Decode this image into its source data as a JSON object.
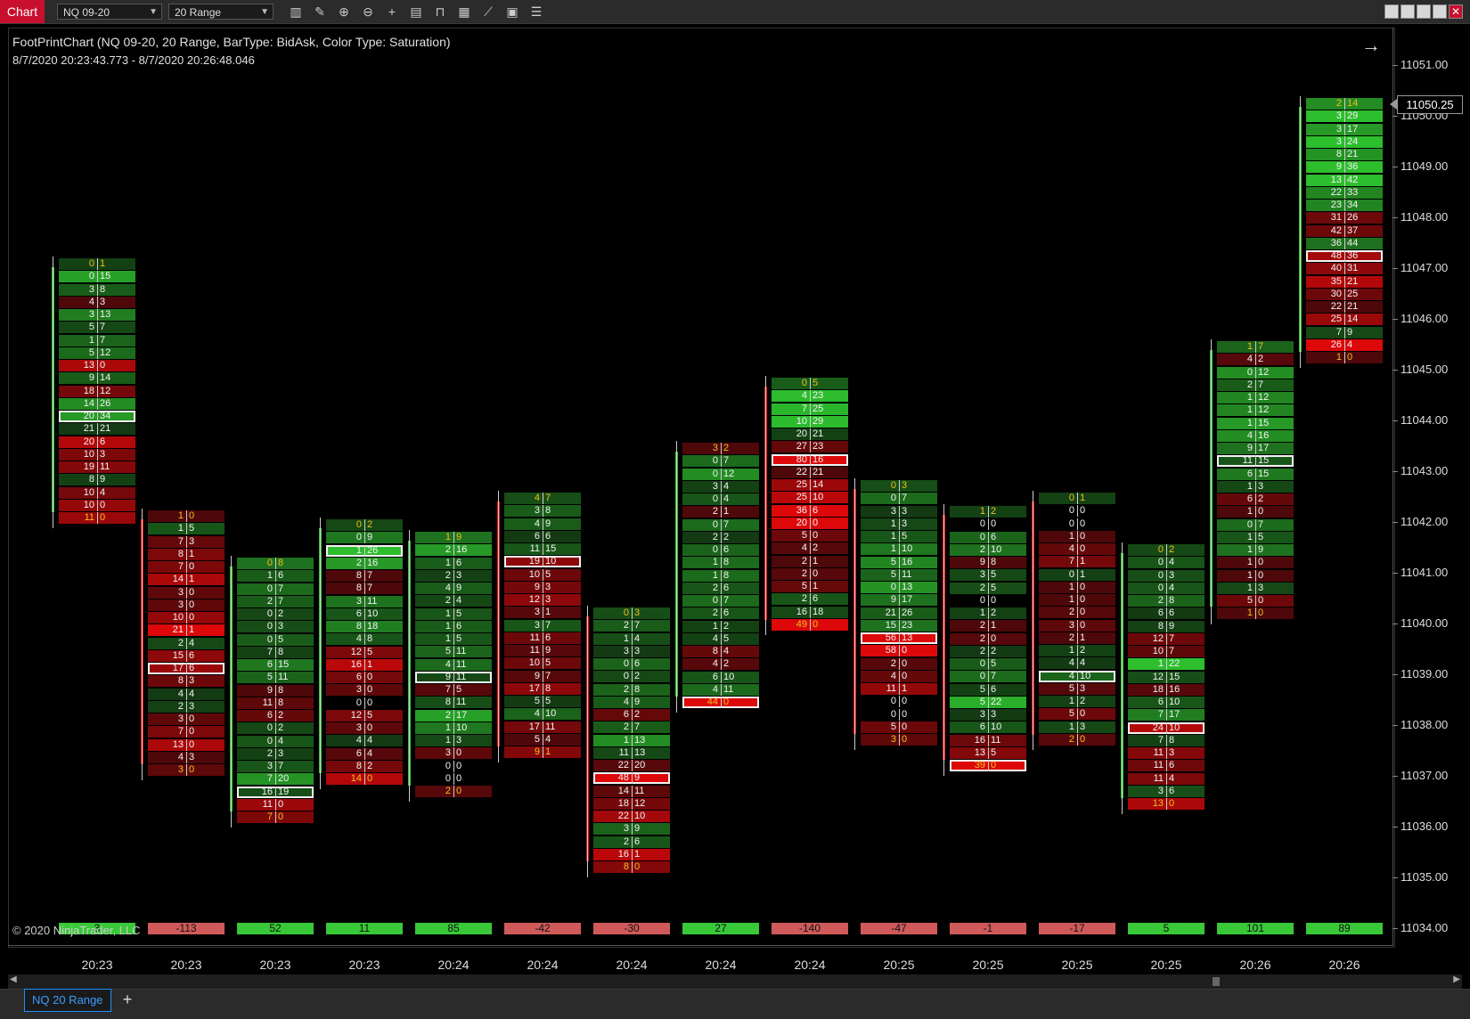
{
  "window": {
    "title": "Chart",
    "instrument": "NQ 09-20",
    "bar_type": "20 Range"
  },
  "toolbar_icons": [
    "bar-type-icon",
    "drawing-tool-icon",
    "zoom-in-icon",
    "zoom-out-icon",
    "crosshair-icon",
    "data-box-icon",
    "properties-icon",
    "indicators-icon",
    "strategies-icon",
    "chart-trader-icon",
    "more-options-icon"
  ],
  "chart": {
    "title": "FootPrintChart (NQ 09-20, 20 Range, BarType: BidAsk, Color Type: Saturation)",
    "range": "8/7/2020 20:23:43.773 - 8/7/2020 20:26:48.046",
    "copyright": "© 2020 NinjaTrader, LLC",
    "last_price": "11050.25"
  },
  "price_axis": [
    "11051.00",
    "11050.00",
    "11049.00",
    "11048.00",
    "11047.00",
    "11046.00",
    "11045.00",
    "11044.00",
    "11043.00",
    "11042.00",
    "11041.00",
    "11040.00",
    "11039.00",
    "11038.00",
    "11037.00",
    "11036.00",
    "11035.00",
    "11034.00"
  ],
  "time_labels": [
    "20:23",
    "20:23",
    "20:23",
    "20:23",
    "20:24",
    "20:24",
    "20:24",
    "20:24",
    "20:24",
    "20:25",
    "20:25",
    "20:25",
    "20:25",
    "20:26",
    "20:26"
  ],
  "bars": [
    {
      "cells": [
        [
          0,
          1
        ],
        [
          0,
          15
        ],
        [
          3,
          8
        ],
        [
          4,
          3
        ],
        [
          3,
          13
        ],
        [
          5,
          7
        ],
        [
          1,
          7
        ],
        [
          5,
          12
        ],
        [
          13,
          0
        ],
        [
          9,
          14
        ],
        [
          18,
          12
        ],
        [
          14,
          26
        ],
        [
          20,
          34
        ],
        [
          21,
          21
        ],
        [
          20,
          6
        ],
        [
          10,
          3
        ],
        [
          19,
          11
        ],
        [
          8,
          9
        ],
        [
          10,
          4
        ],
        [
          10,
          0
        ],
        [
          11,
          0
        ]
      ],
      "poc": 12,
      "delta": "3"
    },
    {
      "cells": [
        [
          1,
          0
        ],
        [
          1,
          5
        ],
        [
          7,
          3
        ],
        [
          8,
          1
        ],
        [
          7,
          0
        ],
        [
          14,
          1
        ],
        [
          3,
          0
        ],
        [
          3,
          0
        ],
        [
          10,
          0
        ],
        [
          21,
          1
        ],
        [
          2,
          4
        ],
        [
          15,
          6
        ],
        [
          17,
          6
        ],
        [
          8,
          3
        ],
        [
          4,
          4
        ],
        [
          2,
          3
        ],
        [
          3,
          0
        ],
        [
          7,
          0
        ],
        [
          13,
          0
        ],
        [
          4,
          3
        ],
        [
          3,
          0
        ]
      ],
      "poc": 12,
      "delta": "-113"
    },
    {
      "cells": [
        [
          0,
          8
        ],
        [
          1,
          6
        ],
        [
          0,
          7
        ],
        [
          2,
          7
        ],
        [
          0,
          2
        ],
        [
          0,
          3
        ],
        [
          0,
          5
        ],
        [
          7,
          8
        ],
        [
          6,
          15
        ],
        [
          5,
          11
        ],
        [
          9,
          8
        ],
        [
          11,
          8
        ],
        [
          6,
          2
        ],
        [
          0,
          2
        ],
        [
          0,
          4
        ],
        [
          2,
          3
        ],
        [
          3,
          7
        ],
        [
          7,
          20
        ],
        [
          16,
          19
        ],
        [
          11,
          0
        ],
        [
          7,
          0
        ]
      ],
      "poc": 18,
      "delta": "52"
    },
    {
      "cells": [
        [
          0,
          2
        ],
        [
          0,
          9
        ],
        [
          1,
          26
        ],
        [
          2,
          16
        ],
        [
          8,
          7
        ],
        [
          8,
          7
        ],
        [
          3,
          11
        ],
        [
          6,
          10
        ],
        [
          8,
          18
        ],
        [
          4,
          8
        ],
        [
          12,
          5
        ],
        [
          16,
          1
        ],
        [
          6,
          0
        ],
        [
          3,
          0
        ],
        [
          0,
          0
        ],
        [
          12,
          5
        ],
        [
          3,
          0
        ],
        [
          4,
          4
        ],
        [
          6,
          4
        ],
        [
          8,
          2
        ],
        [
          14,
          0
        ]
      ],
      "poc": 2,
      "delta": "11"
    },
    {
      "cells": [
        [
          1,
          9
        ],
        [
          2,
          16
        ],
        [
          1,
          6
        ],
        [
          2,
          3
        ],
        [
          4,
          9
        ],
        [
          2,
          4
        ],
        [
          1,
          5
        ],
        [
          1,
          6
        ],
        [
          1,
          5
        ],
        [
          5,
          11
        ],
        [
          4,
          11
        ],
        [
          9,
          11
        ],
        [
          7,
          5
        ],
        [
          8,
          11
        ],
        [
          2,
          17
        ],
        [
          1,
          10
        ],
        [
          1,
          3
        ],
        [
          3,
          0
        ],
        [
          0,
          0
        ],
        [
          0,
          0
        ],
        [
          2,
          0
        ]
      ],
      "poc": 11,
      "delta": "85"
    },
    {
      "cells": [
        [
          4,
          7
        ],
        [
          3,
          8
        ],
        [
          4,
          9
        ],
        [
          6,
          6
        ],
        [
          11,
          15
        ],
        [
          19,
          10
        ],
        [
          10,
          5
        ],
        [
          9,
          3
        ],
        [
          12,
          3
        ],
        [
          3,
          1
        ],
        [
          3,
          7
        ],
        [
          11,
          6
        ],
        [
          11,
          9
        ],
        [
          10,
          5
        ],
        [
          9,
          7
        ],
        [
          17,
          8
        ],
        [
          5,
          5
        ],
        [
          4,
          10
        ],
        [
          17,
          11
        ],
        [
          5,
          4
        ],
        [
          9,
          1
        ]
      ],
      "poc": 5,
      "delta": "-42"
    },
    {
      "cells": [
        [
          0,
          3
        ],
        [
          2,
          7
        ],
        [
          1,
          4
        ],
        [
          3,
          3
        ],
        [
          0,
          6
        ],
        [
          0,
          2
        ],
        [
          2,
          8
        ],
        [
          4,
          9
        ],
        [
          6,
          2
        ],
        [
          2,
          7
        ],
        [
          1,
          13
        ],
        [
          11,
          13
        ],
        [
          22,
          20
        ],
        [
          48,
          9
        ],
        [
          14,
          11
        ],
        [
          18,
          12
        ],
        [
          22,
          10
        ],
        [
          3,
          9
        ],
        [
          2,
          6
        ],
        [
          16,
          1
        ],
        [
          8,
          0
        ]
      ],
      "poc": 13,
      "delta": "-30"
    },
    {
      "cells": [
        [
          3,
          2
        ],
        [
          0,
          7
        ],
        [
          0,
          12
        ],
        [
          3,
          4
        ],
        [
          0,
          4
        ],
        [
          2,
          1
        ],
        [
          0,
          7
        ],
        [
          2,
          2
        ],
        [
          0,
          6
        ],
        [
          1,
          8
        ],
        [
          1,
          8
        ],
        [
          2,
          6
        ],
        [
          0,
          7
        ],
        [
          2,
          6
        ],
        [
          1,
          2
        ],
        [
          4,
          5
        ],
        [
          8,
          4
        ],
        [
          4,
          2
        ],
        [
          6,
          10
        ],
        [
          4,
          11
        ],
        [
          44,
          0
        ]
      ],
      "poc": 20,
      "delta": "27"
    },
    {
      "cells": [
        [
          0,
          5
        ],
        [
          4,
          23
        ],
        [
          7,
          25
        ],
        [
          10,
          29
        ],
        [
          20,
          21
        ],
        [
          27,
          23
        ],
        [
          80,
          16
        ],
        [
          22,
          21
        ],
        [
          25,
          14
        ],
        [
          25,
          10
        ],
        [
          36,
          6
        ],
        [
          20,
          0
        ],
        [
          5,
          0
        ],
        [
          4,
          2
        ],
        [
          2,
          1
        ],
        [
          2,
          0
        ],
        [
          5,
          1
        ],
        [
          2,
          6
        ],
        [
          16,
          18
        ],
        [
          49,
          0
        ]
      ],
      "poc": 6,
      "delta": "-140"
    },
    {
      "cells": [
        [
          0,
          3
        ],
        [
          0,
          7
        ],
        [
          3,
          3
        ],
        [
          1,
          3
        ],
        [
          1,
          5
        ],
        [
          1,
          10
        ],
        [
          5,
          16
        ],
        [
          5,
          11
        ],
        [
          0,
          13
        ],
        [
          9,
          17
        ],
        [
          21,
          26
        ],
        [
          15,
          23
        ],
        [
          56,
          13
        ],
        [
          58,
          0
        ],
        [
          2,
          0
        ],
        [
          4,
          0
        ],
        [
          11,
          1
        ],
        [
          0,
          0
        ],
        [
          0,
          0
        ],
        [
          5,
          0
        ],
        [
          3,
          0
        ]
      ],
      "poc": 12,
      "delta": "-47"
    },
    {
      "cells": [
        [
          1,
          2
        ],
        [
          0,
          0
        ],
        [
          0,
          6
        ],
        [
          2,
          10
        ],
        [
          9,
          8
        ],
        [
          3,
          5
        ],
        [
          2,
          5
        ],
        [
          0,
          0
        ],
        [
          1,
          2
        ],
        [
          2,
          1
        ],
        [
          2,
          0
        ],
        [
          2,
          2
        ],
        [
          0,
          5
        ],
        [
          0,
          7
        ],
        [
          5,
          6
        ],
        [
          5,
          22
        ],
        [
          3,
          3
        ],
        [
          6,
          10
        ],
        [
          16,
          11
        ],
        [
          13,
          5
        ],
        [
          39,
          0
        ]
      ],
      "poc": 20,
      "delta": "-1"
    },
    {
      "cells": [
        [
          0,
          1
        ],
        [
          0,
          0
        ],
        [
          0,
          0
        ],
        [
          1,
          0
        ],
        [
          4,
          0
        ],
        [
          7,
          1
        ],
        [
          0,
          1
        ],
        [
          1,
          0
        ],
        [
          1,
          0
        ],
        [
          2,
          0
        ],
        [
          3,
          0
        ],
        [
          2,
          1
        ],
        [
          1,
          2
        ],
        [
          4,
          4
        ],
        [
          4,
          10
        ],
        [
          5,
          3
        ],
        [
          1,
          2
        ],
        [
          5,
          0
        ],
        [
          1,
          3
        ],
        [
          2,
          0
        ]
      ],
      "poc": 14,
      "delta": "-17"
    },
    {
      "cells": [
        [
          0,
          2
        ],
        [
          0,
          4
        ],
        [
          0,
          3
        ],
        [
          0,
          4
        ],
        [
          2,
          8
        ],
        [
          6,
          6
        ],
        [
          8,
          9
        ],
        [
          12,
          7
        ],
        [
          10,
          7
        ],
        [
          1,
          22
        ],
        [
          12,
          15
        ],
        [
          18,
          16
        ],
        [
          6,
          10
        ],
        [
          7,
          17
        ],
        [
          24,
          10
        ],
        [
          7,
          8
        ],
        [
          11,
          3
        ],
        [
          11,
          6
        ],
        [
          11,
          4
        ],
        [
          3,
          6
        ],
        [
          13,
          0
        ]
      ],
      "poc": 14,
      "delta": "5"
    },
    {
      "cells": [
        [
          1,
          7
        ],
        [
          4,
          2
        ],
        [
          0,
          12
        ],
        [
          2,
          7
        ],
        [
          1,
          12
        ],
        [
          1,
          12
        ],
        [
          1,
          15
        ],
        [
          4,
          16
        ],
        [
          9,
          17
        ],
        [
          11,
          15
        ],
        [
          6,
          15
        ],
        [
          1,
          3
        ],
        [
          6,
          2
        ],
        [
          1,
          0
        ],
        [
          0,
          7
        ],
        [
          1,
          5
        ],
        [
          1,
          9
        ],
        [
          1,
          0
        ],
        [
          1,
          0
        ],
        [
          1,
          3
        ],
        [
          5,
          0
        ],
        [
          1,
          0
        ]
      ],
      "poc": 9,
      "delta": "101"
    },
    {
      "cells": [
        [
          2,
          14
        ],
        [
          3,
          29
        ],
        [
          3,
          17
        ],
        [
          3,
          24
        ],
        [
          8,
          21
        ],
        [
          9,
          36
        ],
        [
          13,
          42
        ],
        [
          22,
          33
        ],
        [
          23,
          34
        ],
        [
          31,
          26
        ],
        [
          42,
          37
        ],
        [
          36,
          44
        ],
        [
          48,
          36
        ],
        [
          40,
          31
        ],
        [
          35,
          21
        ],
        [
          30,
          25
        ],
        [
          22,
          21
        ],
        [
          25,
          14
        ],
        [
          7,
          9
        ],
        [
          26,
          4
        ],
        [
          1,
          0
        ]
      ],
      "poc": 12,
      "delta": "89"
    }
  ],
  "tabs": {
    "active": "NQ 20 Range",
    "add": "+"
  },
  "colors": {
    "up": "#38c038",
    "down": "#e01818",
    "poc_outline": "#f2f2f2",
    "delta_pos": "#38c838",
    "delta_neg": "#d05a5a",
    "accent": "#c8102e"
  }
}
